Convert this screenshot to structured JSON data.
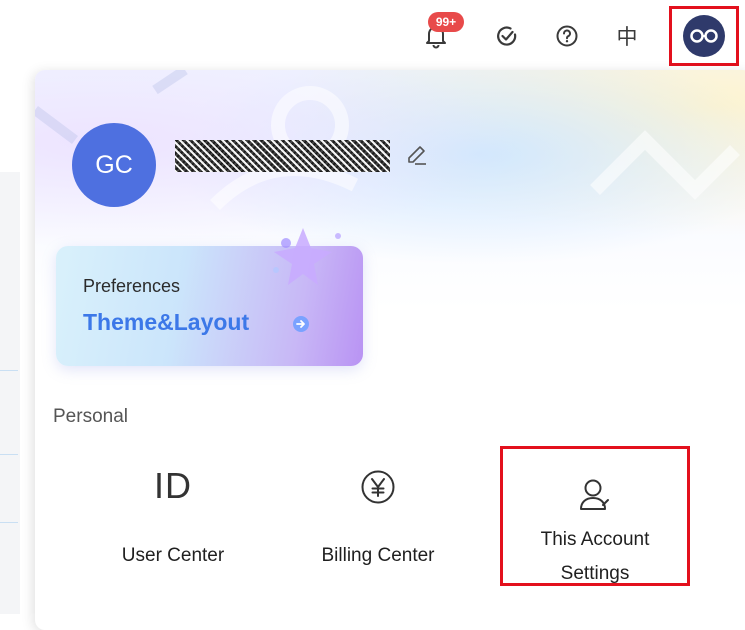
{
  "topbar": {
    "notification_badge": "99+",
    "language_label": "中",
    "icons": [
      "bell-icon",
      "task-check-icon",
      "help-icon",
      "avatar-icon"
    ],
    "badge_color": "#e84a4a",
    "highlight_color": "#e3101d"
  },
  "profile": {
    "avatar_initials": "GC",
    "username_redacted": "redacted",
    "edit_icon": "pencil-icon",
    "avatar_color": "#4e70e0"
  },
  "preferences_card": {
    "title": "Preferences",
    "subtitle": "Theme&Layout",
    "accent_color": "#3c78e8"
  },
  "personal": {
    "section_label": "Personal",
    "items": [
      {
        "label": "User Center",
        "icon": "id-icon"
      },
      {
        "label": "Billing Center",
        "icon": "yen-circle-icon"
      },
      {
        "label": "This Account Settings",
        "label_line1": "This Account",
        "label_line2": "Settings",
        "icon": "user-edit-icon"
      }
    ]
  }
}
